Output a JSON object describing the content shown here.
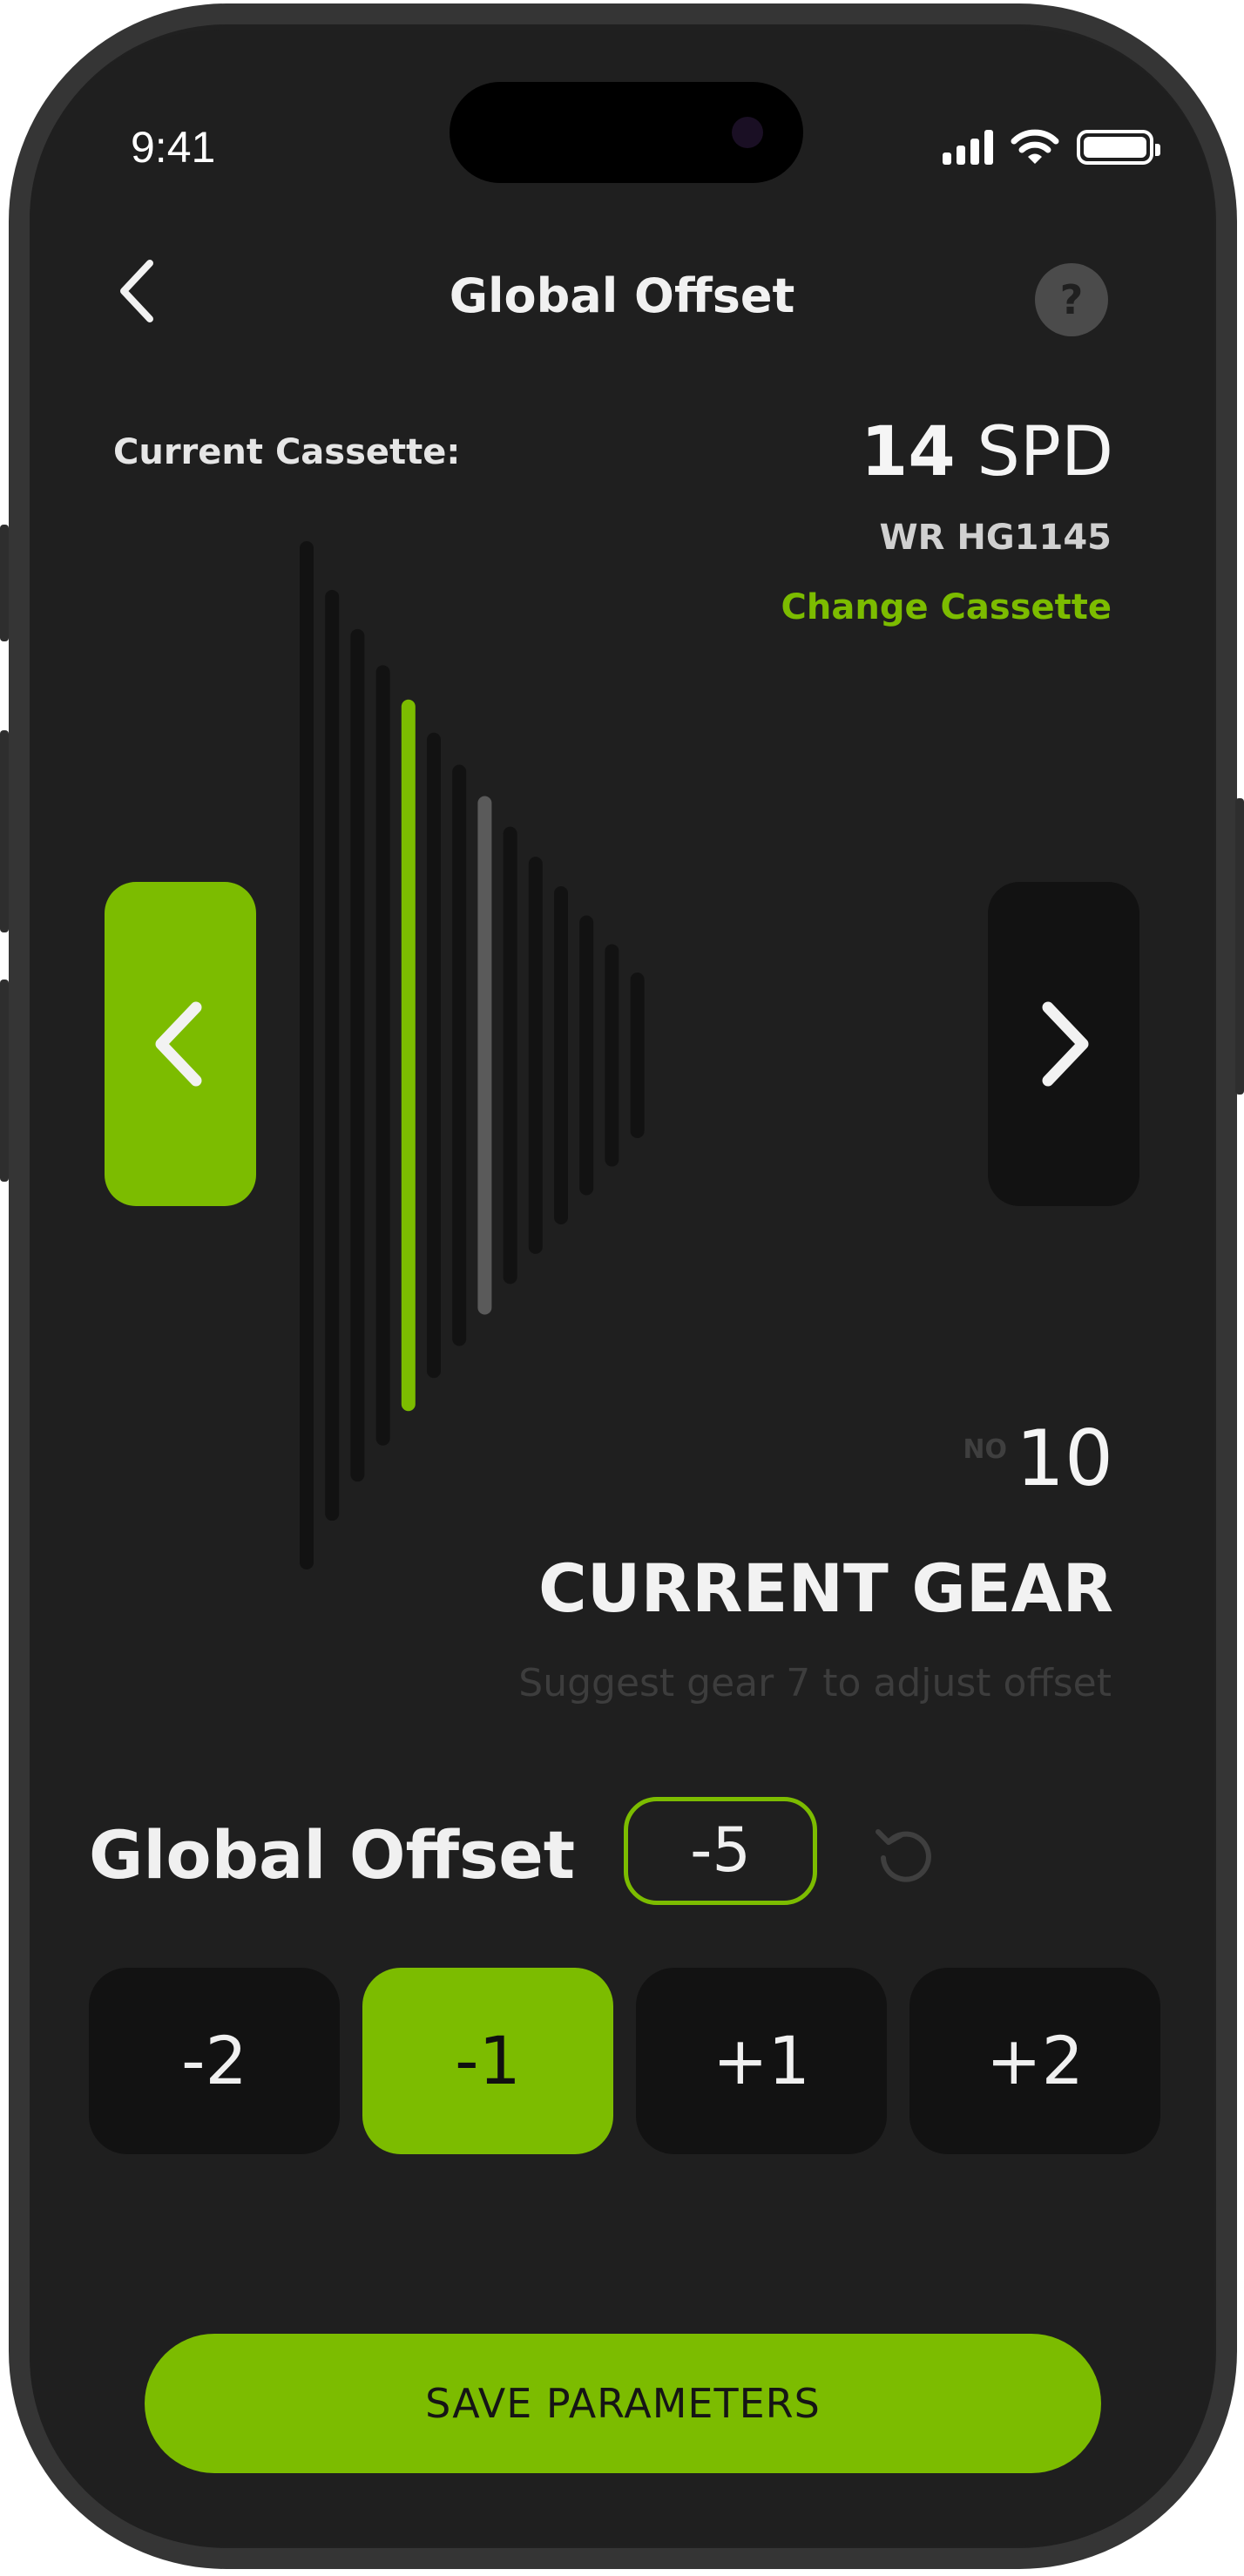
{
  "status_bar": {
    "time": "9:41"
  },
  "header": {
    "title": "Global Offset",
    "help": "?"
  },
  "cassette": {
    "label": "Current Cassette:",
    "speed_number": "14",
    "speed_unit": "SPD",
    "model": "WR HG1145",
    "change_link": "Change Cassette"
  },
  "gear_visual": {
    "cog_count": 14,
    "current_cog": 5,
    "suggested_cog": 8
  },
  "current_gear": {
    "no_label": "NO",
    "number": "10",
    "title": "CURRENT GEAR",
    "suggestion": "Suggest gear 7 to adjust offset"
  },
  "offset": {
    "label": "Global Offset",
    "value": "-5",
    "steps": [
      {
        "label": "-2",
        "active": false
      },
      {
        "label": "-1",
        "active": true
      },
      {
        "label": "+1",
        "active": false
      },
      {
        "label": "+2",
        "active": false
      }
    ]
  },
  "save_button": "SAVE PARAMETERS",
  "colors": {
    "accent": "#7cbc00",
    "background": "#1f1f1f",
    "inactive_cog": "#121212",
    "suggested_cog": "#5a5a5a"
  }
}
